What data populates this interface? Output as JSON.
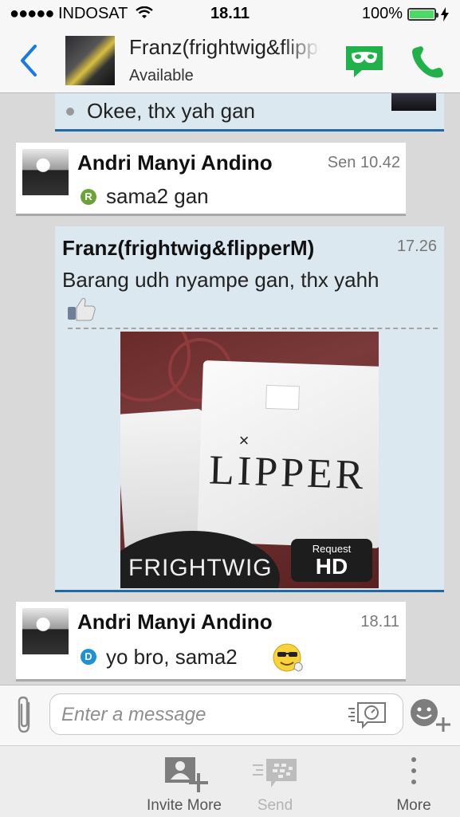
{
  "status_bar": {
    "carrier": "INDOSAT",
    "time": "18.11",
    "battery": "100%",
    "signal_dots": 5
  },
  "header": {
    "contact_name": "Franz(frightwig&flipperM)",
    "contact_status": "Available"
  },
  "messages": [
    {
      "direction": "outgoing",
      "text": "Okee, thx yah gan"
    },
    {
      "direction": "incoming",
      "sender": "Andri Manyi Andino",
      "time": "Sen 10.42",
      "status_letter": "R",
      "text": "sama2 gan"
    },
    {
      "direction": "outgoing",
      "sender": "Franz(frightwig&flipperM)",
      "time": "17.26",
      "text": "Barang udh nyampe gan, thx yahh",
      "image": {
        "hd_request": "Request",
        "hd_label": "HD",
        "shirt_text": "LIPPER",
        "shirt_text_small": "×",
        "logo_text": "FRIGHTWIG"
      }
    },
    {
      "direction": "incoming",
      "sender": "Andri Manyi Andino",
      "time": "18.11",
      "status_letter": "D",
      "text": "yo bro, sama2"
    }
  ],
  "composer": {
    "placeholder": "Enter a message"
  },
  "toolbar": {
    "invite_label": "Invite More",
    "send_label": "Send",
    "more_label": "More"
  },
  "colors": {
    "accent": "#1e6aa5",
    "back": "#1a7ae0",
    "green": "#20b14a",
    "badge_r": "#6aa436",
    "badge_d": "#1e90d6"
  }
}
